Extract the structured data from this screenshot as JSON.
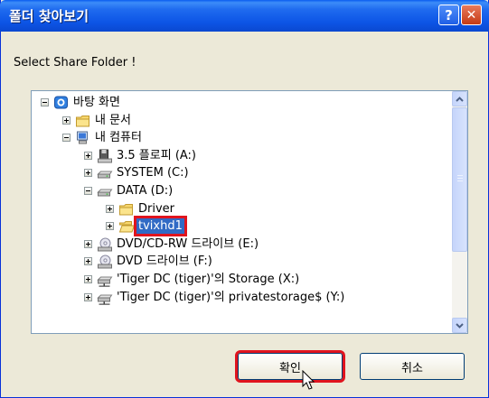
{
  "window": {
    "title": "폴더 찾아보기",
    "help_label": "?",
    "close_label": "✕"
  },
  "prompt": "Select Share Folder !",
  "tree": [
    {
      "label": "바탕 화면",
      "icon": "desktop-icon",
      "expander": "minus",
      "depth": 0
    },
    {
      "label": "내 문서",
      "icon": "folder-icon",
      "expander": "plus",
      "depth": 1
    },
    {
      "label": "내 컴퓨터",
      "icon": "computer-icon",
      "expander": "minus",
      "depth": 1
    },
    {
      "label": "3.5 플로피 (A:)",
      "icon": "floppy-icon",
      "expander": "plus",
      "depth": 2
    },
    {
      "label": "SYSTEM (C:)",
      "icon": "drive-icon",
      "expander": "plus",
      "depth": 2
    },
    {
      "label": "DATA (D:)",
      "icon": "drive-icon",
      "expander": "minus",
      "depth": 2
    },
    {
      "label": "Driver",
      "icon": "folder-icon",
      "expander": "plus",
      "depth": 3
    },
    {
      "label": "tvixhd1",
      "icon": "folder-open-icon",
      "expander": "plus",
      "depth": 3,
      "selected": true
    },
    {
      "label": "DVD/CD-RW 드라이브 (E:)",
      "icon": "cd-drive-icon",
      "expander": "plus",
      "depth": 2
    },
    {
      "label": "DVD 드라이브 (F:)",
      "icon": "cd-drive-icon",
      "expander": "plus",
      "depth": 2
    },
    {
      "label": "'Tiger DC (tiger)'의 Storage (X:)",
      "icon": "network-drive-icon",
      "expander": "plus",
      "depth": 2
    },
    {
      "label": "'Tiger DC (tiger)'의 privatestorage$ (Y:)",
      "icon": "network-drive-icon",
      "expander": "plus",
      "depth": 2
    }
  ],
  "buttons": {
    "ok": "확인",
    "cancel": "취소"
  },
  "colors": {
    "title_bar": "#0a5ce6",
    "dialog_bg": "#ece9d8",
    "selection": "#316ac5",
    "highlight_box": "#e0141e"
  }
}
